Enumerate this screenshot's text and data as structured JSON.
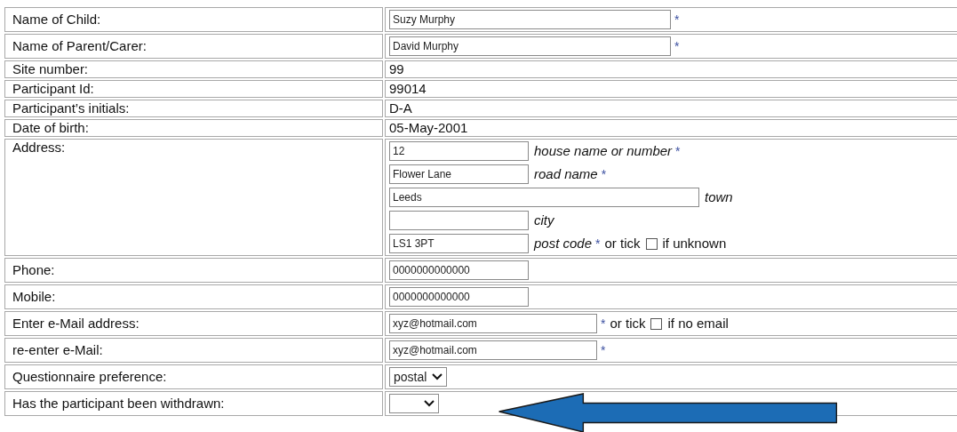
{
  "rows": [
    {
      "kind": "long_input",
      "label": "Name of Child:",
      "value": "Suzy Murphy",
      "star": "*"
    },
    {
      "kind": "long_input",
      "label": "Name of Parent/Carer:",
      "value": "David Murphy",
      "star": "*"
    },
    {
      "kind": "text",
      "label": "Site number:",
      "value": "99"
    },
    {
      "kind": "text",
      "label": "Participant Id:",
      "value": "99014"
    },
    {
      "kind": "text",
      "label": "Participant’s initials:",
      "value": "D-A"
    },
    {
      "kind": "text",
      "label": "Date of birth:",
      "value": "05-May-2001"
    },
    {
      "kind": "address",
      "label": "Address:",
      "lines": [
        {
          "value": "12",
          "hint": "house name or number",
          "star": "*"
        },
        {
          "value": "Flower Lane",
          "hint": "road name",
          "star": "*"
        },
        {
          "value": "Leeds",
          "hint": "town"
        },
        {
          "hint": "city"
        },
        {
          "value": "LS1 3PT",
          "hint": "post code",
          "star": "*",
          "tick": {
            "prefix": "or tick",
            "checked": false,
            "text": "if unknown"
          }
        }
      ]
    },
    {
      "kind": "short_input",
      "label": "Phone:",
      "value": "0000000000000"
    },
    {
      "kind": "short_input",
      "label": "Mobile:",
      "value": "0000000000000"
    },
    {
      "kind": "email_input",
      "label": "Enter e-Mail address:",
      "value": "xyz@hotmail.com",
      "star": "*",
      "tick": {
        "prefix": "or tick",
        "checked": false,
        "text": "if no email"
      }
    },
    {
      "kind": "email_input",
      "label": "re-enter e-Mail:",
      "value": "xyz@hotmail.com",
      "star": "*"
    },
    {
      "kind": "select",
      "label": "Questionnaire preference:",
      "value": "postal"
    },
    {
      "kind": "select",
      "label": "Has the participant been withdrawn:"
    }
  ]
}
